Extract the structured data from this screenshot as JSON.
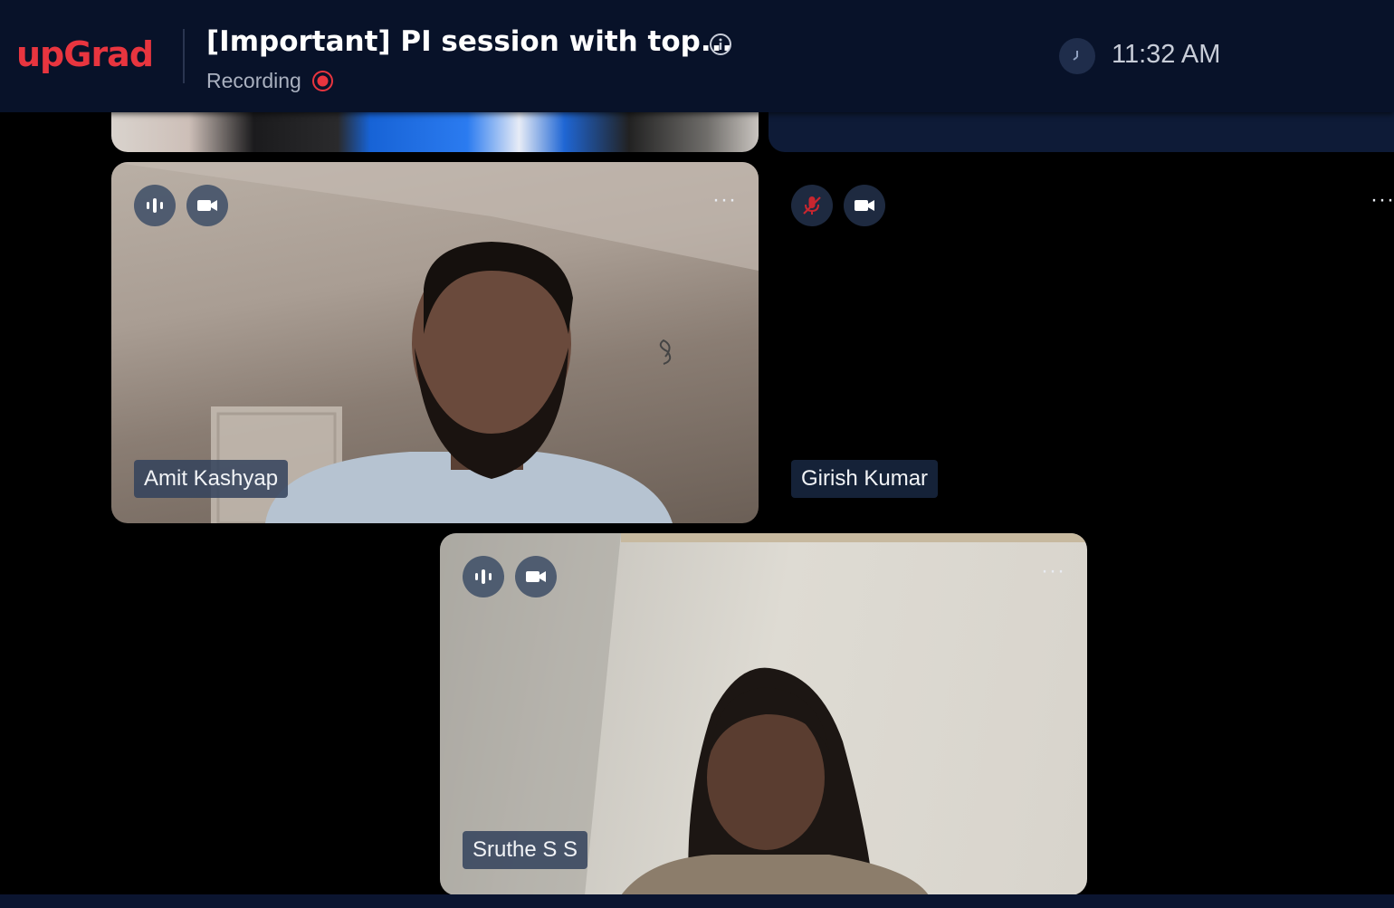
{
  "header": {
    "logo": "upGrad",
    "title": "[Important] PI session with top...",
    "recording_label": "Recording",
    "time": "11:32 AM"
  },
  "icons": {
    "info": "info-icon",
    "recording": "recording-dot-icon",
    "clock": "clock-icon",
    "audio": "audio-wave-icon",
    "muted": "mic-muted-icon",
    "video": "video-camera-icon",
    "more": "more-options-icon"
  },
  "participants": [
    {
      "name": "Amit Kashyap",
      "audio": "active",
      "video": "on"
    },
    {
      "name": "Girish Kumar",
      "audio": "muted",
      "video": "on"
    },
    {
      "name": "Sruthe S S",
      "audio": "active",
      "video": "on"
    }
  ],
  "more_label": "···",
  "colors": {
    "brand": "#e8353f",
    "header_bg": "#081229",
    "muted_mic": "#c8262f",
    "chip_bg": "#32425c"
  }
}
